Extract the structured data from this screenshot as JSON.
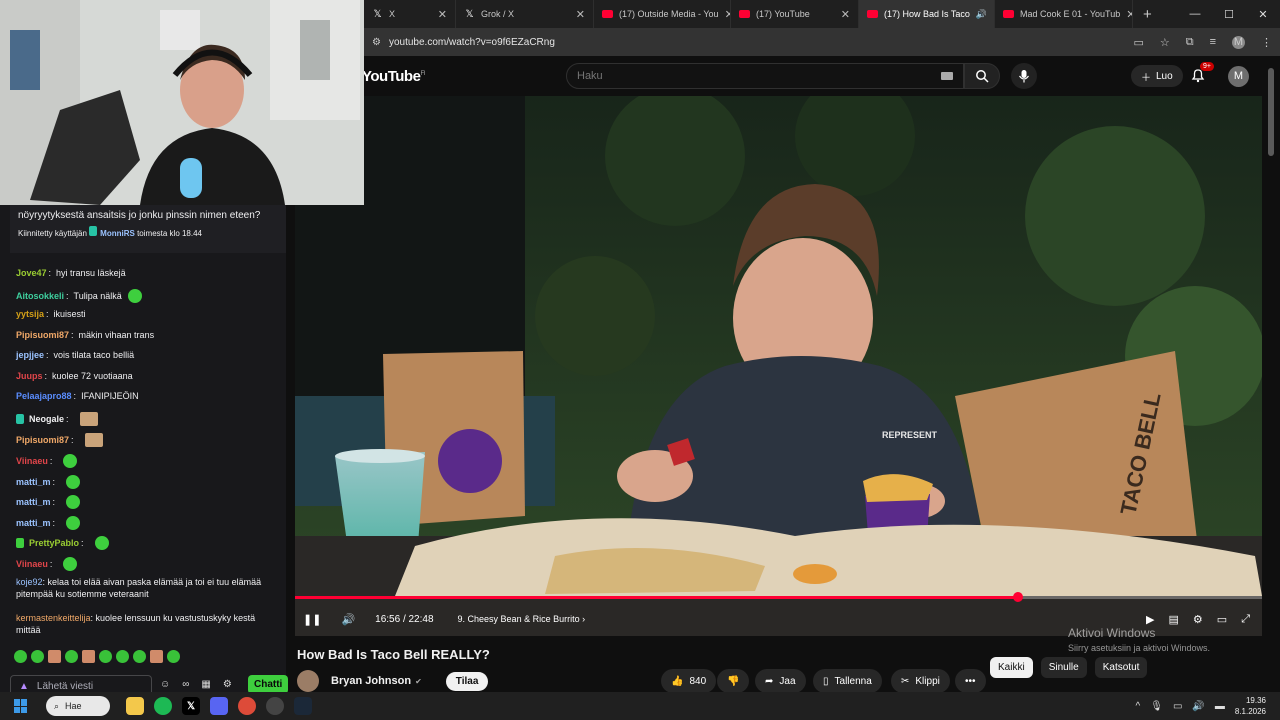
{
  "browser": {
    "tabs": [
      {
        "icon": "x-icon",
        "title": "X",
        "active": false
      },
      {
        "icon": "x-icon",
        "title": "Grok / X",
        "active": false
      },
      {
        "icon": "youtube-icon",
        "title": "(17) Outside Media - You",
        "active": false
      },
      {
        "icon": "youtube-icon",
        "title": "(17) YouTube",
        "active": false
      },
      {
        "icon": "youtube-icon",
        "title": "(17) How Bad Is Taco",
        "active": true
      },
      {
        "icon": "youtube-icon",
        "title": "Mad Cook E 01 - YouTub",
        "active": false
      }
    ],
    "url": "youtube.com/watch?v=o9f6EZaCRng",
    "profile_initial": "M"
  },
  "youtube": {
    "logo": "YouTube",
    "logo_region": "FI",
    "search_placeholder": "Haku",
    "create_label": "Luo",
    "notification_count": "9+",
    "avatar_initial": "M"
  },
  "video": {
    "progress_fraction": 0.748,
    "time": "16:56 / 22:48",
    "chapter": "9. Cheesy Bean & Rice Burrito",
    "title": "How Bad Is Taco Bell REALLY?",
    "bag_text": "TACO BELL",
    "hoodie_text": "REPRESENT"
  },
  "channel": {
    "name": "Bryan Johnson",
    "subscribe_label": "Tilaa",
    "likes": "840",
    "share_label": "Jaa",
    "save_label": "Tallenna",
    "clip_label": "Klippi"
  },
  "filter_chips": [
    {
      "label": "Kaikki",
      "selected": true
    },
    {
      "label": "Sinulle",
      "selected": false
    },
    {
      "label": "Katsotut",
      "selected": false
    }
  ],
  "watermark": {
    "line1": "Aktivoi Windows",
    "line2": "Siirry asetuksiin ja aktivoi Windows."
  },
  "chat": {
    "pinned_message": "nöyryytyksestä ansaitsis jo jonku pinssin nimen eteen?",
    "pinned_prefix": "Kiinnitetty käyttäjän",
    "pinned_user": "MonniRS",
    "pinned_suffix": "toimesta klo 18.44",
    "messages": [
      {
        "user": "Jove47",
        "color": "#9acd32",
        "text": "hyi transu läskejä",
        "emote": false
      },
      {
        "user": "Aitosokkeli",
        "color": "#3ecf9e",
        "text": "Tulipa nälkä",
        "emote": true
      },
      {
        "user": "yytsija",
        "color": "#d4a017",
        "text": "ikuisesti",
        "emote": false
      },
      {
        "user": "Pipisuomi87",
        "color": "#f0a868",
        "text": "mäkin vihaan trans",
        "emote": false
      },
      {
        "user": "jepjjee",
        "color": "#9bc3ff",
        "text": "vois tilata taco belliä",
        "emote": false
      },
      {
        "user": "Juups",
        "color": "#e0454a",
        "text": "kuolee 72 vuotiaana",
        "emote": false
      },
      {
        "user": "Pelaajapro88",
        "color": "#5a8dff",
        "text": "IFANIPIJEÖIN",
        "emote": false
      },
      {
        "user": "Neogale",
        "color": "#efeff1",
        "text": "",
        "emote": true
      },
      {
        "user": "Pipisuomi87",
        "color": "#f0a868",
        "text": "",
        "emote": true
      },
      {
        "user": "Viinaeu",
        "color": "#e0454a",
        "text": "",
        "emote": true
      },
      {
        "user": "matti_m",
        "color": "#9bc3ff",
        "text": "",
        "emote": true
      },
      {
        "user": "matti_m",
        "color": "#9bc3ff",
        "text": "",
        "emote": true
      },
      {
        "user": "matti_m",
        "color": "#9bc3ff",
        "text": "",
        "emote": true
      },
      {
        "user": "PrettyPablo",
        "color": "#9acd32",
        "text": "",
        "emote": true
      },
      {
        "user": "Viinaeu",
        "color": "#e0454a",
        "text": "",
        "emote": true
      }
    ],
    "long_messages": [
      {
        "user": "koje92",
        "color": "#9bc3ff",
        "text": "kelaa toi elää aivan paska elämää ja toi ei tuu elämää pitempää ku sotiemme veteraanit"
      },
      {
        "user": "kermastenkeittelija",
        "color": "#f0a868",
        "text": "kuolee lenssuun ku vastustuskyky kestä mittää"
      }
    ],
    "input_placeholder": "Lähetä viesti",
    "send_label": "Chatti"
  },
  "taskbar": {
    "search_label": "Hae",
    "time": "19.36",
    "date": "8.1.2026"
  }
}
